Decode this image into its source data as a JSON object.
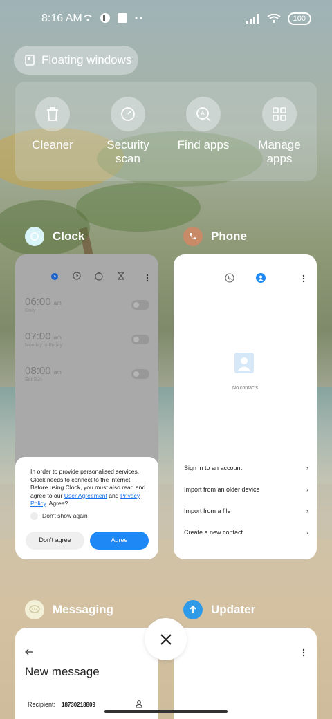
{
  "status_bar": {
    "time": "8:16 AM",
    "battery": "100"
  },
  "floating_windows": {
    "label": "Floating windows"
  },
  "quick_actions": [
    {
      "label": "Cleaner",
      "icon": "trash-icon"
    },
    {
      "label": "Security\nscan",
      "icon": "security-scan-icon"
    },
    {
      "label": "Find apps",
      "icon": "find-apps-icon"
    },
    {
      "label": "Manage\napps",
      "icon": "grid-icon"
    }
  ],
  "apps": {
    "clock": {
      "title": "Clock",
      "alarms": [
        {
          "time": "06:00",
          "ampm": "am",
          "sub": "Daily"
        },
        {
          "time": "07:00",
          "ampm": "am",
          "sub": "Monday to Friday"
        },
        {
          "time": "08:00",
          "ampm": "am",
          "sub": "Sat Sun"
        }
      ],
      "dialog": {
        "text_1": "In order to provide personalised services, Clock needs to connect to the internet. Before using Clock, you must also read and agree to our ",
        "link_1": "User Agreement",
        "text_2": " and ",
        "link_2": "Privacy Policy",
        "text_3": ". Agree?",
        "checkbox": "Don't show again",
        "disagree": "Don't agree",
        "agree": "Agree"
      }
    },
    "phone": {
      "title": "Phone",
      "empty": "No contacts",
      "actions": [
        "Sign in to an account",
        "Import from an older device",
        "Import from a file",
        "Create a new contact"
      ]
    },
    "messaging": {
      "title": "Messaging",
      "heading": "New message",
      "recipient_label": "Recipient:",
      "recipient_value": "18730218809"
    },
    "updater": {
      "title": "Updater"
    }
  },
  "colors": {
    "accent_blue": "#1e88f5",
    "clock_icon": "#d9f4f8",
    "phone_icon": "#c98a68",
    "updater_icon": "#2f9be8"
  }
}
